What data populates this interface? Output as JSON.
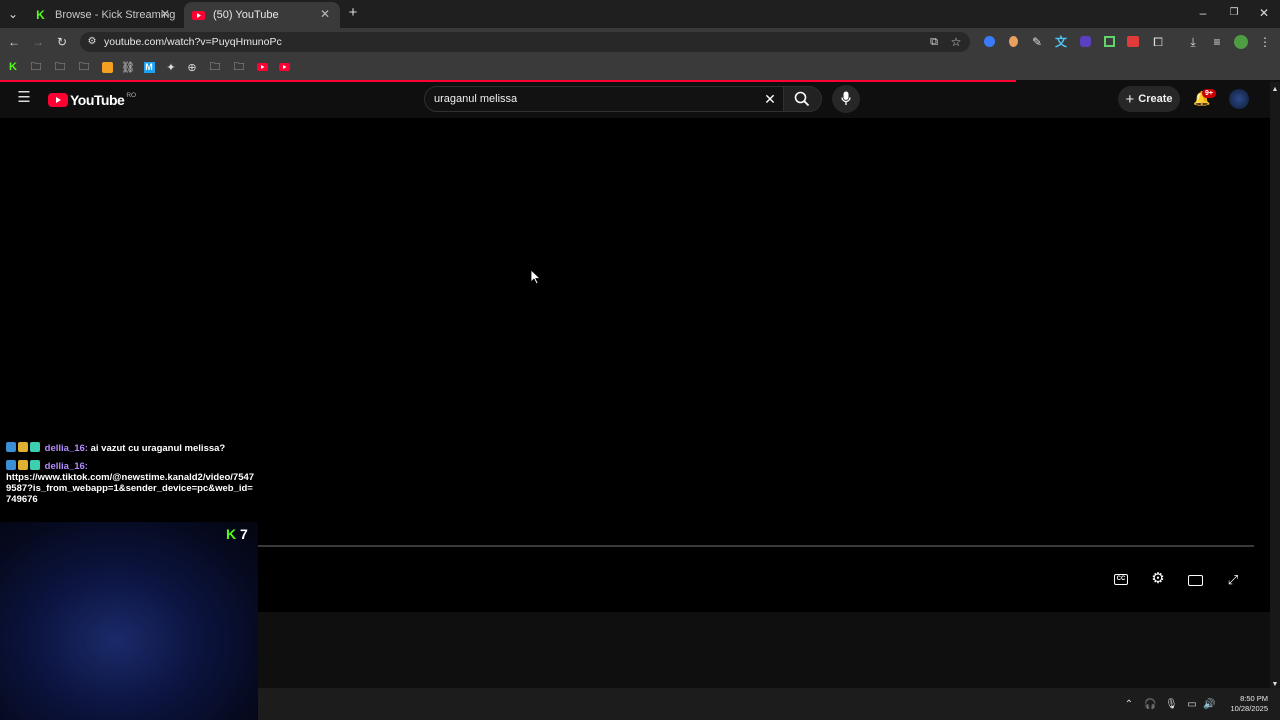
{
  "browser": {
    "tabs": [
      {
        "title": "Browse - Kick Streaming",
        "icon": "kick-icon",
        "active": false
      },
      {
        "title": "(50) YouTube",
        "icon": "youtube-icon",
        "active": true
      }
    ],
    "url": "youtube.com/watch?v=PuyqHmunoPc"
  },
  "youtube": {
    "logo_text": "YouTube",
    "region": "RO",
    "search_value": "uraganul melissa",
    "create_label": "Create",
    "notifications_badge": "9+"
  },
  "chat": {
    "messages": [
      {
        "user": "dellia_16:",
        "text": "ai vazut cu uraganul melissa?"
      },
      {
        "user": "dellia_16:",
        "text": "https://www.tiktok.com/@newstime.kanald2/video/75479587?is_from_webapp=1&sender_device=pc&web_id=749676"
      }
    ]
  },
  "stream": {
    "viewer_count": "7"
  },
  "taskbar": {
    "time": "8:50 PM",
    "date": "10/28/2025"
  },
  "colors": {
    "youtube_red": "#ff0033",
    "kick_green": "#53fc18",
    "chat_user": "#b58cff"
  }
}
